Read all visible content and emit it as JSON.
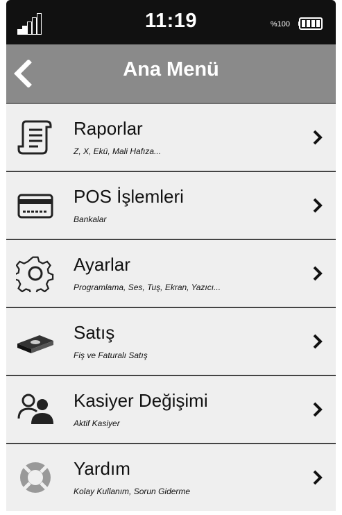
{
  "status_bar": {
    "time": "11:19",
    "battery_percent_label": "%100",
    "signal_icon": "signal-bars-icon",
    "battery_icon": "battery-icon"
  },
  "header": {
    "title": "Ana Menü",
    "back_icon": "back-chevron-icon"
  },
  "menu": {
    "items": [
      {
        "label": "Raporlar",
        "subtitle": "Z, X, Ekü, Mali Hafıza...",
        "icon": "receipt-scroll-icon"
      },
      {
        "label": "POS İşlemleri",
        "subtitle": "Bankalar",
        "icon": "credit-card-icon"
      },
      {
        "label": "Ayarlar",
        "subtitle": "Programlama, Ses, Tuş, Ekran, Yazıcı...",
        "icon": "gear-icon"
      },
      {
        "label": "Satış",
        "subtitle": "Fiş ve Faturalı Satış",
        "icon": "cash-stack-icon"
      },
      {
        "label": "Kasiyer Değişimi",
        "subtitle": "Aktif Kasiyer",
        "icon": "users-icon"
      },
      {
        "label": "Yardım",
        "subtitle": "Kolay Kullanım, Sorun Giderme",
        "icon": "lifebuoy-icon"
      }
    ]
  },
  "colors": {
    "status_bar_bg": "#111111",
    "header_bg": "#8a8a8a",
    "menu_bg": "#efefef"
  }
}
